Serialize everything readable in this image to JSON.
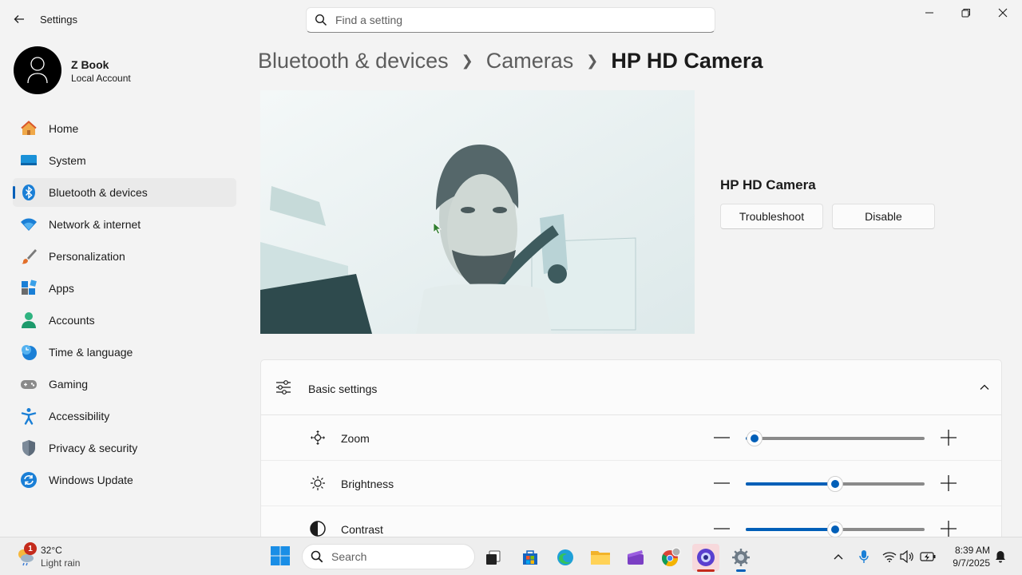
{
  "window": {
    "title": "Settings",
    "search_placeholder": "Find a setting"
  },
  "profile": {
    "name": "Z Book",
    "account_type": "Local Account"
  },
  "sidebar": {
    "items": [
      {
        "label": "Home",
        "icon": "home-icon"
      },
      {
        "label": "System",
        "icon": "system-icon"
      },
      {
        "label": "Bluetooth & devices",
        "icon": "bluetooth-icon",
        "active": true
      },
      {
        "label": "Network & internet",
        "icon": "wifi-icon"
      },
      {
        "label": "Personalization",
        "icon": "brush-icon"
      },
      {
        "label": "Apps",
        "icon": "apps-icon"
      },
      {
        "label": "Accounts",
        "icon": "person-icon"
      },
      {
        "label": "Time & language",
        "icon": "clock-globe-icon"
      },
      {
        "label": "Gaming",
        "icon": "gamepad-icon"
      },
      {
        "label": "Accessibility",
        "icon": "accessibility-icon"
      },
      {
        "label": "Privacy & security",
        "icon": "shield-icon"
      },
      {
        "label": "Windows Update",
        "icon": "update-icon"
      }
    ]
  },
  "breadcrumb": {
    "level1": "Bluetooth & devices",
    "level2": "Cameras",
    "current": "HP HD Camera"
  },
  "camera": {
    "name": "HP HD Camera",
    "troubleshoot_label": "Troubleshoot",
    "disable_label": "Disable"
  },
  "basic_settings": {
    "title": "Basic settings",
    "expanded": true,
    "controls": [
      {
        "label": "Zoom",
        "icon": "zoom-icon",
        "value": 0.05
      },
      {
        "label": "Brightness",
        "icon": "brightness-icon",
        "value": 0.5
      },
      {
        "label": "Contrast",
        "icon": "contrast-icon",
        "value": 0.5
      }
    ]
  },
  "taskbar": {
    "weather": {
      "temp": "32°C",
      "condition": "Light rain",
      "badge": "1"
    },
    "search_label": "Search",
    "time": "8:39 AM",
    "date": "9/7/2025"
  },
  "colors": {
    "accent": "#005fb8",
    "background": "#f3f3f3"
  }
}
